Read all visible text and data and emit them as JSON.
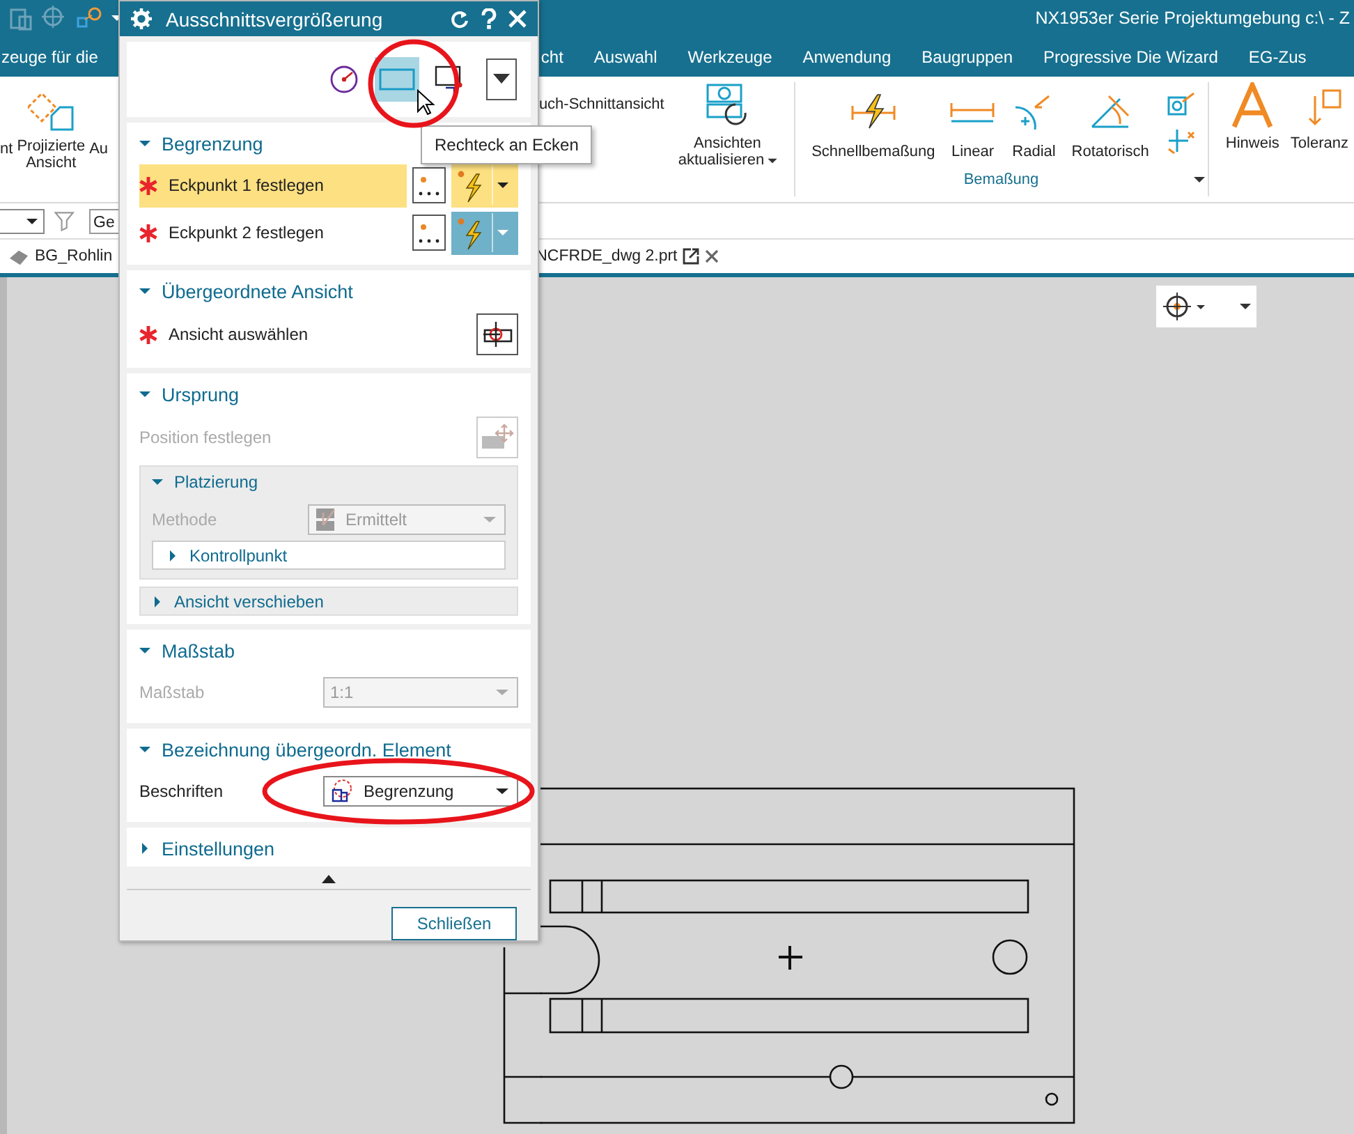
{
  "app_title": "NX1953er Serie Projektumgebung c:\\ - Z",
  "menu": [
    "zeuge für die",
    "cht",
    "Auswahl",
    "Werkzeuge",
    "Anwendung",
    "Baugruppen",
    "Progressive Die Wizard",
    "EG-Zus"
  ],
  "ribbon": {
    "left_labels": [
      "nt",
      "Projizierte\nAnsicht",
      "Au"
    ],
    "section_view_label": "uch-Schnittansicht",
    "update_label": "Ansichten\naktualisieren",
    "dimension_group": {
      "title": "Bemaßung",
      "items": [
        "Schnellbemaßung",
        "Linear",
        "Radial",
        "Rotatorisch"
      ]
    },
    "note_label": "Hinweis",
    "tolerance_label": "Toleranz"
  },
  "filter_field": {
    "value": "Ge"
  },
  "doc_tabs": [
    "BG_Rohlin",
    "NCFRDE_dwg 2.prt"
  ],
  "dialog": {
    "title": "Ausschnittsvergrößerung",
    "method_buttons": [
      {
        "selected": false
      },
      {
        "selected": true
      },
      {
        "selected": false
      }
    ],
    "tooltip": "Rechteck an Ecken",
    "sections": [
      {
        "kind": "points",
        "title": "Begrenzung",
        "expanded": true,
        "rows": [
          {
            "label": "Eckpunkt 1 festlegen",
            "selected": true
          },
          {
            "label": "Eckpunkt 2 festlegen",
            "selected": false
          }
        ]
      },
      {
        "kind": "select",
        "title": "Übergeordnete Ansicht",
        "expanded": true,
        "label": "Ansicht auswählen"
      },
      {
        "kind": "origin",
        "title": "Ursprung",
        "expanded": true,
        "label": "Position festlegen",
        "group": {
          "title": "Platzierung",
          "expanded": true,
          "method_label": "Methode",
          "method_value": "Ermittelt",
          "sub_item": {
            "label": "Kontrollpunkt",
            "expanded": false
          }
        },
        "move_item": {
          "label": "Ansicht verschieben",
          "expanded": false
        }
      },
      {
        "kind": "combo",
        "title": "Maßstab",
        "expanded": true,
        "label": "Maßstab",
        "value": "1:1",
        "disabled": true
      },
      {
        "kind": "combo",
        "title": "Bezeichnung übergeordn. Element",
        "expanded": true,
        "label": "Beschriften",
        "value": "Begrenzung",
        "disabled": false
      },
      {
        "kind": "header",
        "title": "Einstellungen",
        "expanded": false
      }
    ],
    "close_button": "Schließen"
  }
}
